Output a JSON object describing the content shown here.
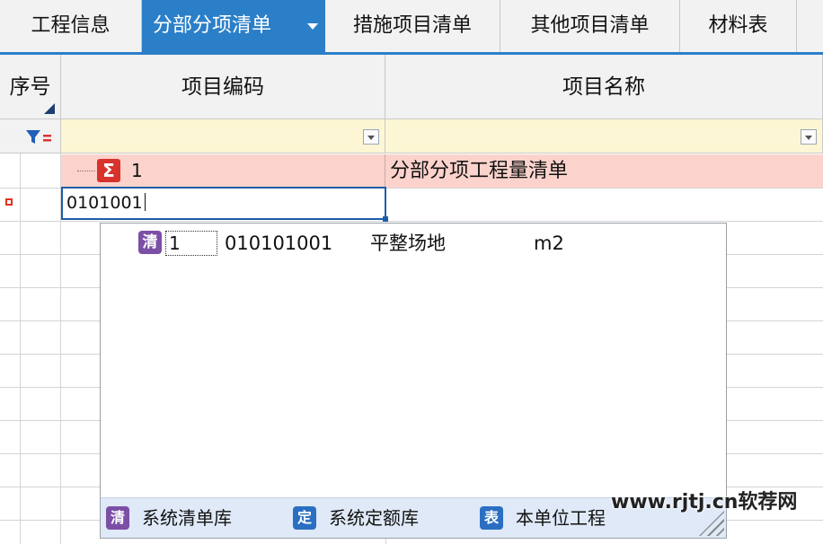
{
  "tabs": [
    {
      "label": "工程信息"
    },
    {
      "label": "分部分项清单"
    },
    {
      "label": "措施项目清单"
    },
    {
      "label": "其他项目清单"
    },
    {
      "label": "材料表"
    }
  ],
  "grid": {
    "headers": {
      "seq": "序号",
      "code": "项目编码",
      "name": "项目名称"
    },
    "summary_row": {
      "number": "1",
      "name": "分部分项工程量清单"
    },
    "code_input_value": "0101001"
  },
  "dropdown": {
    "items": [
      {
        "num": "1",
        "code": "010101001",
        "name": "平整场地",
        "unit": "m2",
        "icon_char": "清"
      }
    ],
    "footer": [
      {
        "label": "系统清单库",
        "icon_char": "清",
        "color": "#7b4fa6"
      },
      {
        "label": "系统定额库",
        "icon_char": "定",
        "color": "#2b6fc2"
      },
      {
        "label": "本单位工程",
        "icon_char": "表",
        "color": "#2b6fc2"
      }
    ]
  },
  "watermark": "www.rjtj.cn软荐网",
  "colors": {
    "accent": "#2b7fc8",
    "summary_row": "#fbd3cc",
    "filter_row": "#fdf6d4"
  }
}
